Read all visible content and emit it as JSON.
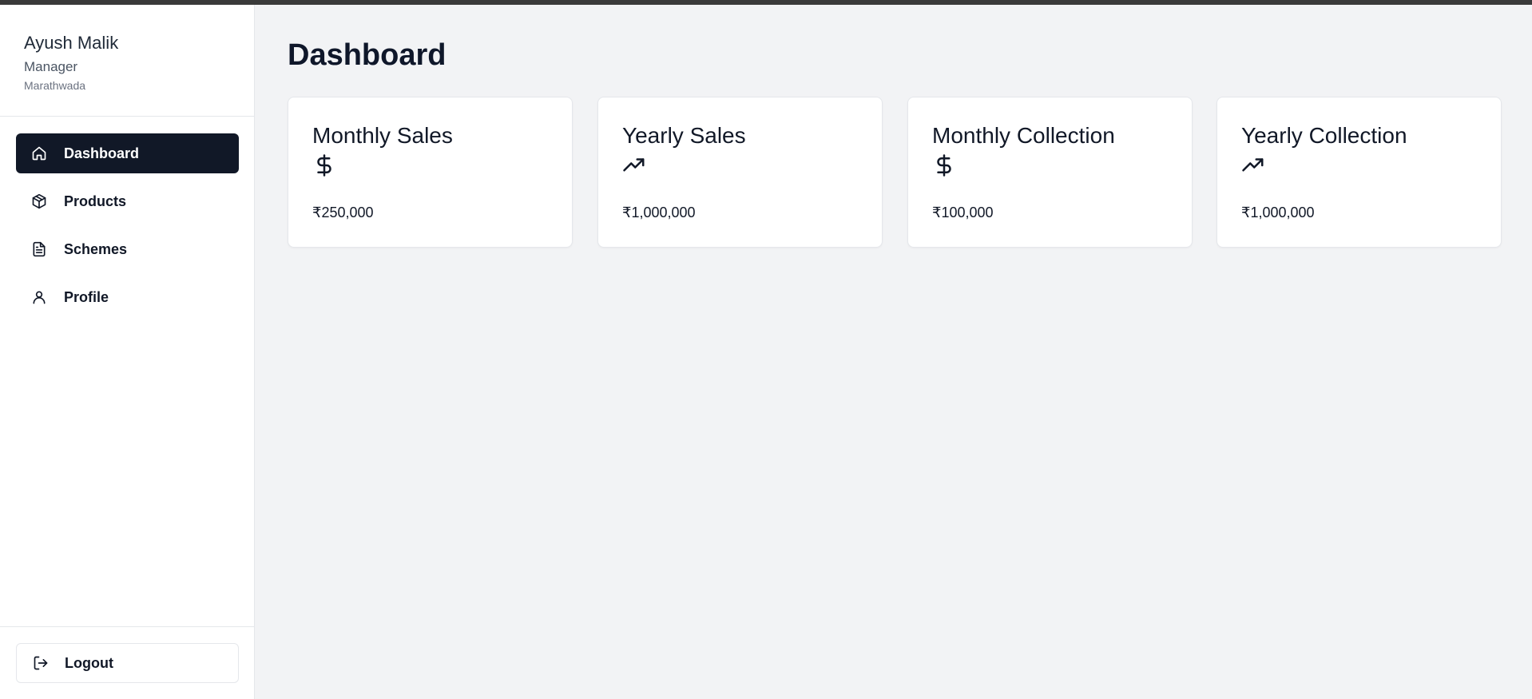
{
  "colors": {
    "accent": "#111827",
    "background": "#f2f3f5",
    "card": "#ffffff",
    "border": "#e5e7eb"
  },
  "user": {
    "name": "Ayush Malik",
    "role": "Manager",
    "region": "Marathwada"
  },
  "sidebar": {
    "items": [
      {
        "label": "Dashboard",
        "icon": "home-icon",
        "active": true
      },
      {
        "label": "Products",
        "icon": "package-icon",
        "active": false
      },
      {
        "label": "Schemes",
        "icon": "file-text-icon",
        "active": false
      },
      {
        "label": "Profile",
        "icon": "user-icon",
        "active": false
      }
    ],
    "logout": {
      "label": "Logout",
      "icon": "logout-icon"
    }
  },
  "main": {
    "title": "Dashboard",
    "cards": [
      {
        "title": "Monthly Sales",
        "icon": "dollar-icon",
        "value": "₹250,000"
      },
      {
        "title": "Yearly Sales",
        "icon": "trending-up-icon",
        "value": "₹1,000,000"
      },
      {
        "title": "Monthly Collection",
        "icon": "dollar-icon",
        "value": "₹100,000"
      },
      {
        "title": "Yearly Collection",
        "icon": "trending-up-icon",
        "value": "₹1,000,000"
      }
    ]
  }
}
